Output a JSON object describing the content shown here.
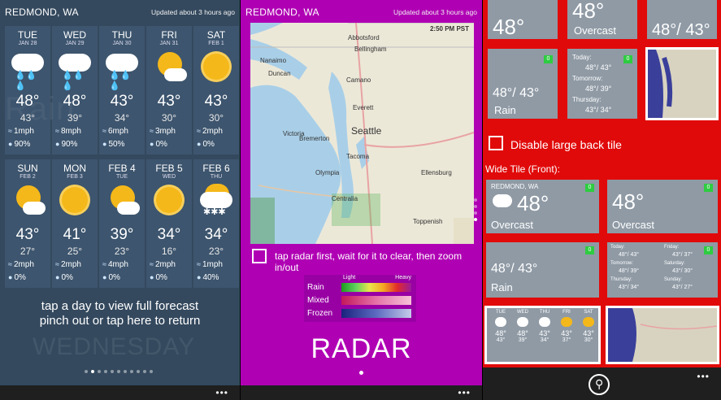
{
  "forecast_panel": {
    "city": "REDMOND, WA",
    "updated": "Updated about 3 hours ago",
    "days": [
      {
        "name": "TUE",
        "date": "JAN 28",
        "icon": "rain-cloud-icon",
        "high": "48°",
        "low": "43°",
        "wind": "1mph",
        "precip": "90%"
      },
      {
        "name": "WED",
        "date": "JAN 29",
        "icon": "rain-cloud-icon",
        "high": "48°",
        "low": "39°",
        "wind": "8mph",
        "precip": "90%"
      },
      {
        "name": "THU",
        "date": "JAN 30",
        "icon": "rain-cloud-icon",
        "high": "43°",
        "low": "34°",
        "wind": "6mph",
        "precip": "50%"
      },
      {
        "name": "FRI",
        "date": "JAN 31",
        "icon": "sun-cloud-icon",
        "high": "43°",
        "low": "30°",
        "wind": "3mph",
        "precip": "0%"
      },
      {
        "name": "SAT",
        "date": "FEB 1",
        "icon": "sun-icon",
        "high": "43°",
        "low": "30°",
        "wind": "2mph",
        "precip": "0%"
      },
      {
        "name": "SUN",
        "date": "FEB 2",
        "icon": "sun-cloud-icon",
        "high": "43°",
        "low": "27°",
        "wind": "2mph",
        "precip": "0%"
      },
      {
        "name": "MON",
        "date": "FEB 3",
        "icon": "sun-icon",
        "high": "41°",
        "low": "25°",
        "wind": "2mph",
        "precip": "0%"
      },
      {
        "name": "FEB 4",
        "date": "TUE",
        "icon": "sun-cloud-icon",
        "high": "39°",
        "low": "23°",
        "wind": "4mph",
        "precip": "0%"
      },
      {
        "name": "FEB 5",
        "date": "WED",
        "icon": "sun-icon",
        "high": "34°",
        "low": "16°",
        "wind": "2mph",
        "precip": "0%"
      },
      {
        "name": "FEB 6",
        "date": "THU",
        "icon": "snow-cloud-icon",
        "high": "34°",
        "low": "23°",
        "wind": "1mph",
        "precip": "40%"
      }
    ],
    "hint_line1": "tap a day to view full forecast",
    "hint_line2": "pinch out or tap here to return",
    "ghost_day": "WEDNESDAY"
  },
  "radar_panel": {
    "city": "REDMOND, WA",
    "updated": "Updated about 3 hours ago",
    "map_time": "2:50 PM PST",
    "map_labels": [
      "Abbotsford",
      "Bellingham",
      "Nanaimo",
      "Duncan",
      "Victoria",
      "Camano",
      "Everett",
      "Seattle",
      "Bremerton",
      "Tacoma",
      "Olympia",
      "Centralia",
      "Ellensburg",
      "Toppenish"
    ],
    "hint": "tap radar first, wait for it to clear, then zoom in/out",
    "legend": {
      "light": "Light",
      "heavy": "Heavy",
      "rain": "Rain",
      "mixed": "Mixed",
      "frozen": "Frozen"
    },
    "title": "RADAR"
  },
  "tiles_panel": {
    "top_left_temp": "48°",
    "top_mid_temp": "48°",
    "top_mid_label": "Overcast",
    "top_right_temp": "48°/ 43°",
    "medium": {
      "temp": "48°/ 43°",
      "label": "Rain",
      "badge": "0"
    },
    "detail": {
      "badge": "0",
      "today": "Today:",
      "today_val": "48°/ 43°",
      "tomorrow": "Tomorrow:",
      "tomorrow_val": "48°/ 39°",
      "thursday": "Thursday:",
      "thursday_val": "43°/ 34°"
    },
    "disable_large_back": "Disable large back tile",
    "wide_front_heading": "Wide Tile (Front):",
    "wide1": {
      "city": "REDMOND, WA",
      "temp": "48°",
      "label": "Overcast",
      "badge": "0"
    },
    "wide2": {
      "temp": "48°",
      "label": "Overcast",
      "badge": "0"
    },
    "wide3": {
      "temp": "48°/ 43°",
      "label": "Rain",
      "badge": "0"
    },
    "wide4": {
      "badge": "0",
      "today": "Today:",
      "today_val": "48°/ 43°",
      "tomorrow": "Tomorrow:",
      "tomorrow_val": "48°/ 39°",
      "thursday": "Thursday:",
      "thursday_val": "43°/ 34°",
      "friday": "Friday:",
      "friday_val": "43°/ 37°",
      "saturday": "Saturday:",
      "saturday_val": "43°/ 30°",
      "sunday": "Sunday:",
      "sunday_val": "43°/ 27°"
    },
    "wide5_days": [
      {
        "name": "TUE",
        "hi": "48°",
        "lo": "43°"
      },
      {
        "name": "WED",
        "hi": "48°",
        "lo": "39°"
      },
      {
        "name": "THU",
        "hi": "43°",
        "lo": "34°"
      },
      {
        "name": "FRI",
        "hi": "43°",
        "lo": "37°"
      },
      {
        "name": "SAT",
        "hi": "43°",
        "lo": "30°"
      }
    ]
  },
  "colors": {
    "forecast_bg": "#34495e",
    "radar_bg": "#b000b4",
    "tiles_bg": "#e10a0a",
    "tile": "#8f9aa5",
    "badge": "#2ecc40"
  }
}
